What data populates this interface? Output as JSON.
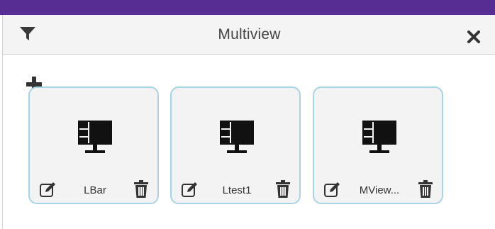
{
  "panel": {
    "title": "Multiview",
    "header_icons": {
      "left": "filter-icon",
      "right": "close-icon"
    },
    "add_icon": "plus-icon"
  },
  "tiles": [
    {
      "name": "LBar",
      "icon": "multiview-monitor-icon"
    },
    {
      "name": "Ltest1",
      "icon": "multiview-monitor-icon"
    },
    {
      "name": "MView...",
      "icon": "multiview-monitor-icon"
    }
  ],
  "colors": {
    "top_bar": "#582d93",
    "header_bg": "#f4f4f4",
    "tile_bg": "#f3f3f3",
    "tile_border": "#a9d4e3",
    "icon": "#1a1a1a"
  }
}
